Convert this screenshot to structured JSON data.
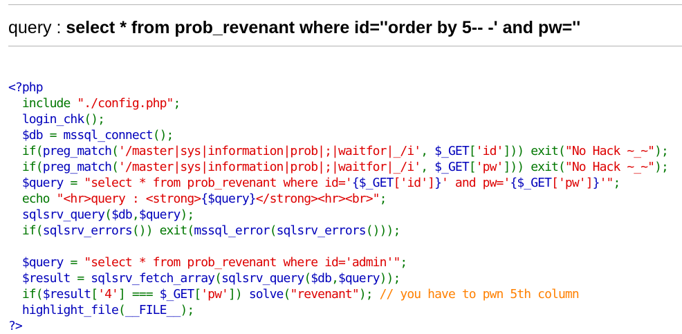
{
  "query_line": {
    "label": "query : ",
    "sql": "select * from prob_revenant where id=''order by 5-- -' and pw=''"
  },
  "source": [
    [
      {
        "t": "<?php",
        "c": "php"
      }
    ],
    [
      {
        "t": "  include ",
        "c": "def"
      },
      {
        "t": "\"./config.php\"",
        "c": "str"
      },
      {
        "t": ";",
        "c": "def"
      }
    ],
    [
      {
        "t": "  login_chk",
        "c": "php"
      },
      {
        "t": "();",
        "c": "def"
      }
    ],
    [
      {
        "t": "  $db ",
        "c": "php"
      },
      {
        "t": "= ",
        "c": "def"
      },
      {
        "t": "mssql_connect",
        "c": "php"
      },
      {
        "t": "();",
        "c": "def"
      }
    ],
    [
      {
        "t": "  if(",
        "c": "def"
      },
      {
        "t": "preg_match",
        "c": "php"
      },
      {
        "t": "(",
        "c": "def"
      },
      {
        "t": "'/master|sys|information|prob|;|waitfor|_/i'",
        "c": "str"
      },
      {
        "t": ", ",
        "c": "def"
      },
      {
        "t": "$_GET",
        "c": "php"
      },
      {
        "t": "[",
        "c": "def"
      },
      {
        "t": "'id'",
        "c": "str"
      },
      {
        "t": "])) exit(",
        "c": "def"
      },
      {
        "t": "\"No Hack ~_~\"",
        "c": "str"
      },
      {
        "t": ");",
        "c": "def"
      }
    ],
    [
      {
        "t": "  if(",
        "c": "def"
      },
      {
        "t": "preg_match",
        "c": "php"
      },
      {
        "t": "(",
        "c": "def"
      },
      {
        "t": "'/master|sys|information|prob|;|waitfor|_/i'",
        "c": "str"
      },
      {
        "t": ", ",
        "c": "def"
      },
      {
        "t": "$_GET",
        "c": "php"
      },
      {
        "t": "[",
        "c": "def"
      },
      {
        "t": "'pw'",
        "c": "str"
      },
      {
        "t": "])) exit(",
        "c": "def"
      },
      {
        "t": "\"No Hack ~_~\"",
        "c": "str"
      },
      {
        "t": ");",
        "c": "def"
      }
    ],
    [
      {
        "t": "  $query ",
        "c": "php"
      },
      {
        "t": "= ",
        "c": "def"
      },
      {
        "t": "\"select * from prob_revenant where id='",
        "c": "str"
      },
      {
        "t": "{$_GET",
        "c": "php"
      },
      {
        "t": "['id']",
        "c": "str"
      },
      {
        "t": "}",
        "c": "php"
      },
      {
        "t": "' and pw='",
        "c": "str"
      },
      {
        "t": "{$_GET",
        "c": "php"
      },
      {
        "t": "['pw']",
        "c": "str"
      },
      {
        "t": "}",
        "c": "php"
      },
      {
        "t": "'\"",
        "c": "str"
      },
      {
        "t": ";",
        "c": "def"
      }
    ],
    [
      {
        "t": "  echo ",
        "c": "def"
      },
      {
        "t": "\"<hr>query : <strong>",
        "c": "str"
      },
      {
        "t": "{$query}",
        "c": "php"
      },
      {
        "t": "</strong><hr><br>\"",
        "c": "str"
      },
      {
        "t": ";",
        "c": "def"
      }
    ],
    [
      {
        "t": "  sqlsrv_query",
        "c": "php"
      },
      {
        "t": "(",
        "c": "def"
      },
      {
        "t": "$db",
        "c": "php"
      },
      {
        "t": ",",
        "c": "def"
      },
      {
        "t": "$query",
        "c": "php"
      },
      {
        "t": ");",
        "c": "def"
      }
    ],
    [
      {
        "t": "  if(",
        "c": "def"
      },
      {
        "t": "sqlsrv_errors",
        "c": "php"
      },
      {
        "t": "()) exit(",
        "c": "def"
      },
      {
        "t": "mssql_error",
        "c": "php"
      },
      {
        "t": "(",
        "c": "def"
      },
      {
        "t": "sqlsrv_errors",
        "c": "php"
      },
      {
        "t": "()));",
        "c": "def"
      }
    ],
    [
      {
        "t": " ",
        "c": "def"
      }
    ],
    [
      {
        "t": "  $query ",
        "c": "php"
      },
      {
        "t": "= ",
        "c": "def"
      },
      {
        "t": "\"select * from prob_revenant where id='admin'\"",
        "c": "str"
      },
      {
        "t": ";",
        "c": "def"
      }
    ],
    [
      {
        "t": "  $result ",
        "c": "php"
      },
      {
        "t": "= ",
        "c": "def"
      },
      {
        "t": "sqlsrv_fetch_array",
        "c": "php"
      },
      {
        "t": "(",
        "c": "def"
      },
      {
        "t": "sqlsrv_query",
        "c": "php"
      },
      {
        "t": "(",
        "c": "def"
      },
      {
        "t": "$db",
        "c": "php"
      },
      {
        "t": ",",
        "c": "def"
      },
      {
        "t": "$query",
        "c": "php"
      },
      {
        "t": "));",
        "c": "def"
      }
    ],
    [
      {
        "t": "  if(",
        "c": "def"
      },
      {
        "t": "$result",
        "c": "php"
      },
      {
        "t": "[",
        "c": "def"
      },
      {
        "t": "'4'",
        "c": "str"
      },
      {
        "t": "] === ",
        "c": "def"
      },
      {
        "t": "$_GET",
        "c": "php"
      },
      {
        "t": "[",
        "c": "def"
      },
      {
        "t": "'pw'",
        "c": "str"
      },
      {
        "t": "]) ",
        "c": "def"
      },
      {
        "t": "solve",
        "c": "php"
      },
      {
        "t": "(",
        "c": "def"
      },
      {
        "t": "\"revenant\"",
        "c": "str"
      },
      {
        "t": "); ",
        "c": "def"
      },
      {
        "t": "// you have to pwn 5th column",
        "c": "cmt"
      }
    ],
    [
      {
        "t": "  highlight_file",
        "c": "php"
      },
      {
        "t": "(",
        "c": "def"
      },
      {
        "t": "__FILE__",
        "c": "php"
      },
      {
        "t": ");",
        "c": "def"
      }
    ],
    [
      {
        "t": "?>",
        "c": "php"
      }
    ]
  ],
  "colors": {
    "default": "#007700",
    "string": "#dd0000",
    "php": "#0000bb",
    "comment": "#ff8000"
  }
}
